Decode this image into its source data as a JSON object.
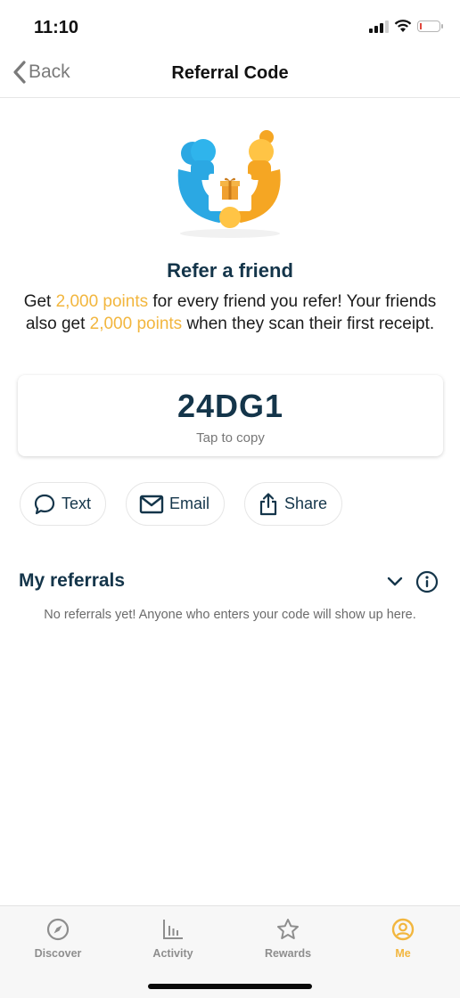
{
  "status_bar": {
    "time": "11:10"
  },
  "nav": {
    "back_label": "Back",
    "title": "Referral Code"
  },
  "hero": {
    "icon": "refer-friends-gift-illustration"
  },
  "refer": {
    "title": "Refer a friend",
    "line1_pre": "Get ",
    "line1_highlight": "2,000 points",
    "line1_post": " for every friend you refer!",
    "line2_pre": "Your friends also get ",
    "line2_highlight": "2,000 points",
    "line2_post": " when they scan their first receipt."
  },
  "code_card": {
    "code": "24DG1",
    "hint": "Tap to copy"
  },
  "share_buttons": [
    {
      "label": "Text",
      "icon": "chat-bubble-icon"
    },
    {
      "label": "Email",
      "icon": "envelope-icon"
    },
    {
      "label": "Share",
      "icon": "share-icon"
    }
  ],
  "referrals": {
    "title": "My referrals",
    "empty_message": "No referrals yet! Anyone who enters your code will show up here."
  },
  "tab_bar": {
    "tabs": [
      {
        "label": "Discover",
        "icon": "compass-icon",
        "active": false
      },
      {
        "label": "Activity",
        "icon": "bar-chart-icon",
        "active": false
      },
      {
        "label": "Rewards",
        "icon": "star-icon",
        "active": false
      },
      {
        "label": "Me",
        "icon": "user-circle-icon",
        "active": true
      }
    ]
  },
  "colors": {
    "accent": "#f2b63e",
    "heading": "#14354a",
    "illustration_blue": "#2ba8e3",
    "illustration_orange": "#f5a623"
  }
}
